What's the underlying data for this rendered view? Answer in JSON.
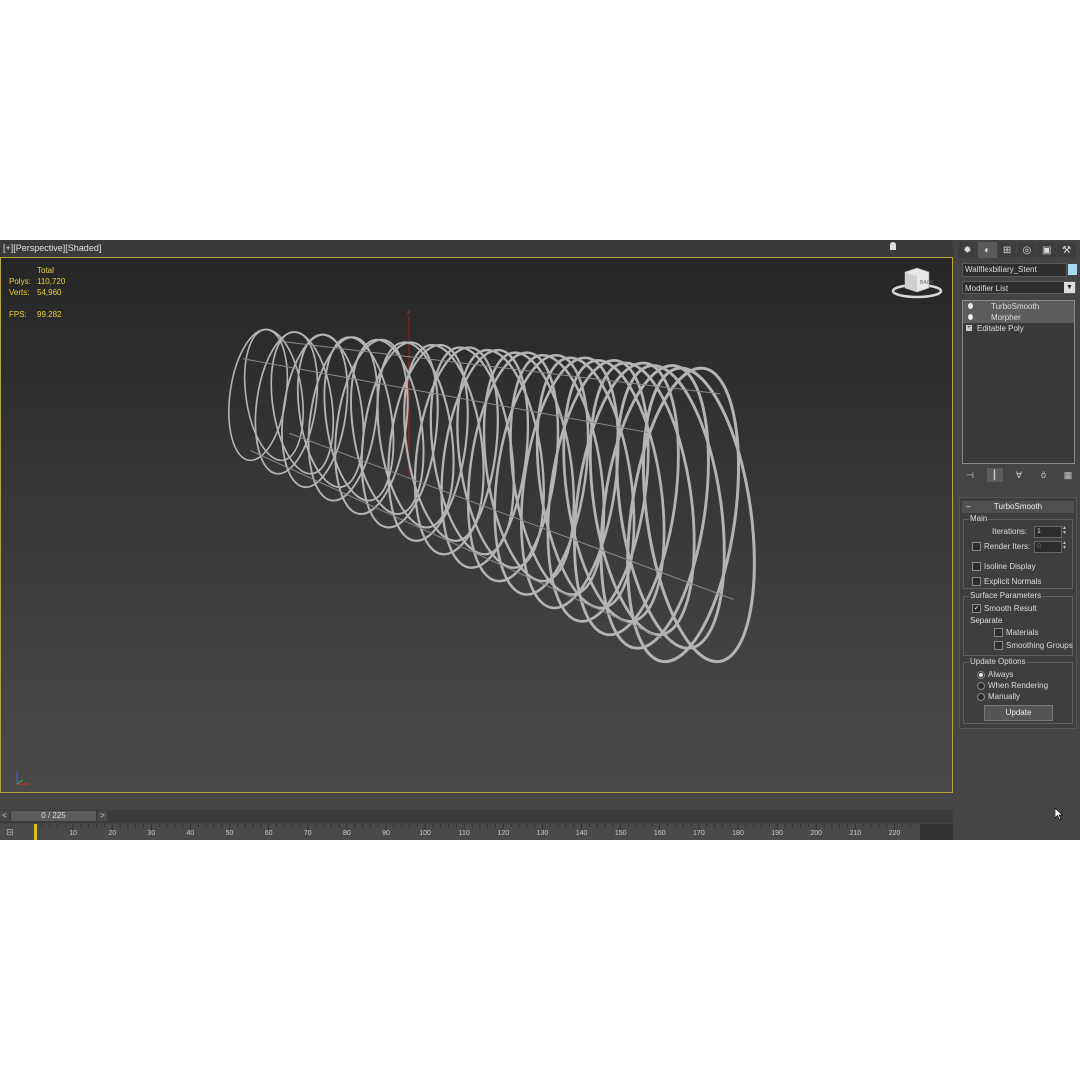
{
  "viewport": {
    "labels": [
      "[+]",
      "[Perspective]",
      "[Shaded]"
    ],
    "stats": {
      "header": "Total",
      "polys_label": "Polys:",
      "polys_value": "110,720",
      "verts_label": "Verts:",
      "verts_value": "54,960",
      "fps_label": "FPS:",
      "fps_value": "99.282"
    },
    "viewcube_label": "BACK",
    "axis_z": "z"
  },
  "command_panel": {
    "tabs": [
      "create-icon",
      "modify-icon",
      "hierarchy-icon",
      "motion-icon",
      "display-icon",
      "utilities-icon"
    ],
    "object_name": "Wallflexbiliary_Stent",
    "object_color": "#a8d8ef",
    "modifier_list": "Modifier List",
    "stack": [
      {
        "label": "TurboSmooth",
        "selected": true
      },
      {
        "label": "Morpher",
        "selected": false
      },
      {
        "label": "Editable Poly",
        "selected": false
      }
    ],
    "rollout": {
      "title": "TurboSmooth",
      "main": {
        "title": "Main",
        "iterations_label": "Iterations:",
        "iterations_value": "1",
        "render_iters_label": "Render Iters:",
        "render_iters_value": "0",
        "isoline_label": "Isoline Display",
        "explicit_normals_label": "Explicit Normals"
      },
      "surface": {
        "title": "Surface Parameters",
        "smooth_result_label": "Smooth Result",
        "separate_label": "Separate",
        "materials_label": "Materials",
        "smoothing_groups_label": "Smoothing Groups"
      },
      "update": {
        "title": "Update Options",
        "always_label": "Always",
        "when_rendering_label": "When Rendering",
        "manually_label": "Manually",
        "button_label": "Update"
      }
    }
  },
  "timeline": {
    "slider_text": "0 / 225",
    "prev": "<",
    "next": ">",
    "ticks": [
      "10",
      "20",
      "30",
      "40",
      "50",
      "60",
      "70",
      "80",
      "90",
      "100",
      "110",
      "120",
      "130",
      "140",
      "150",
      "160",
      "170",
      "180",
      "190",
      "200",
      "210",
      "220"
    ]
  },
  "colors": {
    "viewport_border": "#b8a43a",
    "stats_text": "#e8d23a",
    "mesh": "#b4b4b4"
  }
}
